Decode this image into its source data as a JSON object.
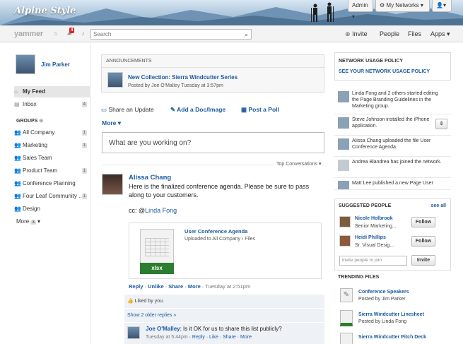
{
  "brand": {
    "logo_text": "Alpine Style",
    "yammer_text": "yammer"
  },
  "topbar": {
    "admin_label": "Admin",
    "networks_label": "My Networks"
  },
  "nav": {
    "notification_count": "4",
    "search_placeholder": "Search",
    "invite_label": "Invite",
    "people_label": "People",
    "files_label": "Files",
    "apps_label": "Apps"
  },
  "sidebar": {
    "user_name": "Jim Parker",
    "my_feed": "My Feed",
    "inbox": "Inbox",
    "inbox_count": "4",
    "groups_heading": "GROUPS",
    "groups": [
      {
        "label": "All Company",
        "count": "1"
      },
      {
        "label": "Marketing",
        "count": "1"
      },
      {
        "label": "Sales Team",
        "count": ""
      },
      {
        "label": "Product Team",
        "count": "1"
      },
      {
        "label": "Conference Planning",
        "count": ""
      },
      {
        "label": "Four Leaf Community ...",
        "count": "1"
      },
      {
        "label": "Design",
        "count": ""
      }
    ],
    "more_label": "More",
    "more_count": "3"
  },
  "announcements": {
    "heading": "ANNOUNCEMENTS",
    "title": "New Collection: Sierra Windcutter Series",
    "meta": "Posted by Joe O'Malley Tuesday at 3:57pm"
  },
  "composer": {
    "share_update": "Share an Update",
    "add_doc": "Add a Doc/Image",
    "post_poll": "Post a Poll",
    "more": "More",
    "placeholder": "What are you working on?",
    "sort_label": "Top Conversations"
  },
  "post": {
    "author": "Alissa Chang",
    "body": "Here is the finalized conference agenda. Please be sure to pass along to your customers.",
    "cc_prefix": "cc: @",
    "cc_name": "Linda Fong",
    "file_title": "User Conference Agenda",
    "file_meta": "Uploaded to All Company › Files",
    "file_badge": "xlsx",
    "actions": [
      "Reply",
      "Unlike",
      "Share",
      "More"
    ],
    "time": "Tuesday at 2:51pm",
    "liked": "Liked by you.",
    "older_replies": "Show 2 older replies »",
    "reply_author": "Joe O'Malley",
    "reply_body": ": Is it OK for us to share this list publicly?",
    "reply_time": "Tuesday at 5:44pm",
    "reply_actions": [
      "Reply",
      "Like",
      "Share",
      "More"
    ]
  },
  "right": {
    "policy_heading": "NETWORK USAGE POLICY",
    "policy_link": "SEE YOUR NETWORK USAGE POLICY",
    "activity": [
      {
        "text": "Linda Fong and 2 others started editing the Page Branding Guidelines in the Marketing group."
      },
      {
        "text": "Steve Johnson installed the iPhone application."
      },
      {
        "text": "Alissa Chang uploaded the file User Conference Agenda."
      },
      {
        "text": "Andrea Blandrea has joined the network."
      },
      {
        "text": "Matt Lee published a new Page User"
      }
    ],
    "suggested_heading": "SUGGESTED PEOPLE",
    "see_all": "see all",
    "people": [
      {
        "name": "Nicole Holbrook",
        "title": "Senior Marketing..."
      },
      {
        "name": "Heidi Phillips",
        "title": "Sr. Visual Desig..."
      }
    ],
    "follow_label": "Follow",
    "invite_placeholder": "Invite people to join",
    "invite_button": "Invite",
    "trending_heading": "TRENDING FILES",
    "files": [
      {
        "name": "Conference Speakers",
        "meta": "Posted by Jim Parker"
      },
      {
        "name": "Sierra Windcutter Linesheet",
        "meta": "Posted by Linda Fong"
      },
      {
        "name": "Sierra Windcutter Pitch Deck",
        "meta": ""
      }
    ]
  },
  "colors": {
    "link": "#1c5aa0",
    "excel_green": "#2b7d2f",
    "badge_red": "#d9232d"
  }
}
